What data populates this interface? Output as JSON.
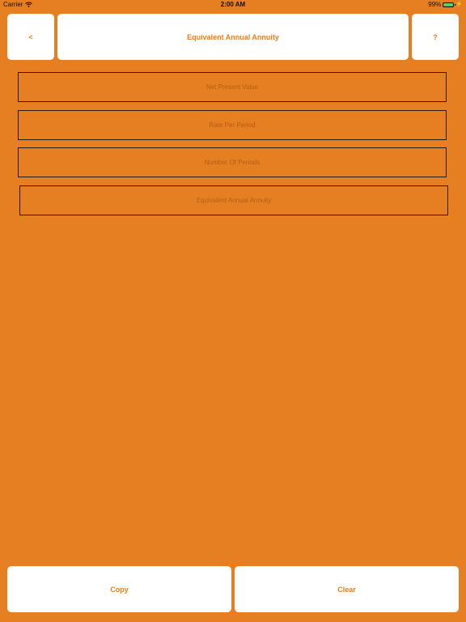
{
  "status_bar": {
    "carrier": "Carrier",
    "time": "2:00 AM",
    "battery_percent": "99%",
    "battery_level": 0.99,
    "battery_color": "#4cd964"
  },
  "header": {
    "back_label": "<",
    "title": "Equivalent Annual Annuity",
    "help_label": "?"
  },
  "fields": {
    "npv": {
      "placeholder": "Net Present Value",
      "value": ""
    },
    "rate": {
      "placeholder": "Rate Per Period",
      "value": ""
    },
    "periods": {
      "placeholder": "Number Of Periods",
      "value": ""
    },
    "result": {
      "placeholder": "Equivalent Annual Annuity",
      "value": ""
    }
  },
  "actions": {
    "copy_label": "Copy",
    "clear_label": "Clear"
  },
  "colors": {
    "background": "#E67E22",
    "button_background": "#FFFFFF",
    "accent_text": "#E67E22",
    "placeholder_text": "#B35F14",
    "field_border": "#2A1A10"
  },
  "icons": {
    "wifi": "wifi-icon",
    "battery": "battery-icon",
    "charging": "charging-icon"
  }
}
